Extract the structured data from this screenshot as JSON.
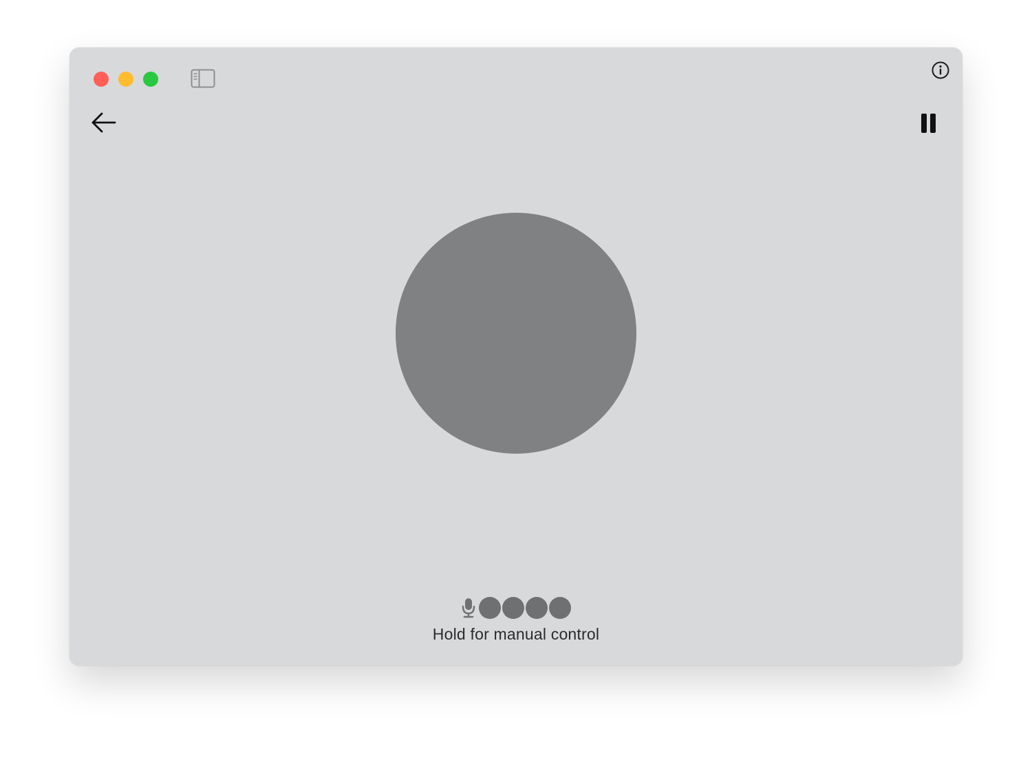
{
  "window": {
    "traffic_lights": [
      {
        "name": "close",
        "color": "#ff5f57"
      },
      {
        "name": "minimize",
        "color": "#febc2e"
      },
      {
        "name": "maximize",
        "color": "#28c840"
      }
    ]
  },
  "icons": {
    "sidebar_toggle": "sidebar-toggle-icon",
    "info": "info-circle-icon",
    "back": "arrow-left-icon",
    "pause": "pause-icon",
    "microphone": "microphone-icon"
  },
  "voice": {
    "orb_color": "#808183",
    "level_dots": 4,
    "hint": "Hold for manual control"
  }
}
